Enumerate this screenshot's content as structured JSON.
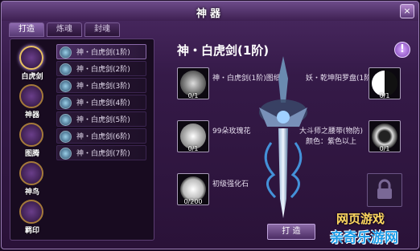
{
  "window": {
    "title": "神器",
    "close_label": "×"
  },
  "tabs": [
    {
      "label": "打造",
      "active": true
    },
    {
      "label": "炼魂",
      "active": false
    },
    {
      "label": "封魂",
      "active": false
    }
  ],
  "categories": [
    {
      "label": "白虎剑",
      "icon": "white-tiger-sword-icon",
      "selected": true
    },
    {
      "label": "神器",
      "icon": "artifact-icon",
      "selected": false
    },
    {
      "label": "图腾",
      "icon": "totem-icon",
      "selected": false
    },
    {
      "label": "神鸟",
      "icon": "divine-bird-icon",
      "selected": false
    },
    {
      "label": "羁印",
      "icon": "seal-icon",
      "selected": false
    }
  ],
  "recipes": [
    {
      "label": "神・白虎剑(1阶)",
      "selected": true
    },
    {
      "label": "神・白虎剑(2阶)",
      "selected": false
    },
    {
      "label": "神・白虎剑(3阶)",
      "selected": false
    },
    {
      "label": "神・白虎剑(4阶)",
      "selected": false
    },
    {
      "label": "神・白虎剑(5阶)",
      "selected": false
    },
    {
      "label": "神・白虎剑(6阶)",
      "selected": false
    },
    {
      "label": "神・白虎剑(7阶)",
      "selected": false
    }
  ],
  "detail": {
    "title": "神・白虎剑(1阶)",
    "info_label": "!",
    "materials": [
      {
        "name": "神・白虎剑(1阶)图纸",
        "count": "0/1",
        "icon": "blueprint-icon"
      },
      {
        "name": "99朵玫瑰花",
        "count": "0/1",
        "icon": "rose-bouquet-icon"
      },
      {
        "name": "初级强化石",
        "count": "0/200",
        "icon": "crystal-stone-icon"
      },
      {
        "name": "妖・乾坤阳罗盘(1阶)",
        "count": "0/1",
        "icon": "yin-yang-compass-icon"
      },
      {
        "name": "大斗师之腰带(物防)",
        "sub": "颜色：紫色以上",
        "count": "0/1",
        "icon": "belt-icon"
      }
    ],
    "forge_button": "打 造"
  },
  "watermark": {
    "line1": "网页游戏",
    "line2": "亲奇乐游网"
  }
}
